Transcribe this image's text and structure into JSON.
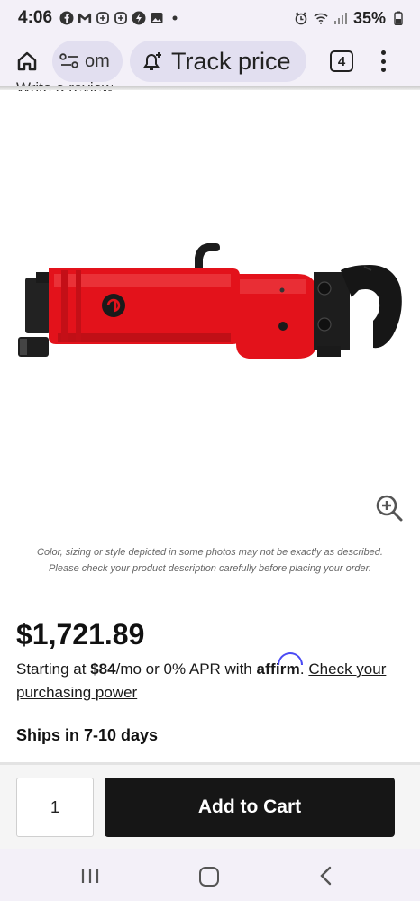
{
  "status_bar": {
    "time": "4:06",
    "battery": "35%",
    "left_icons": [
      "facebook-icon",
      "gmail-icon",
      "teams-icon",
      "teams-icon",
      "bolt-icon",
      "gallery-icon",
      "dot-icon"
    ],
    "right_icons": [
      "alarm-icon",
      "wifi-icon",
      "signal-icon",
      "battery-icon"
    ]
  },
  "browser": {
    "url_fragment": "om",
    "track_price_label": "Track price",
    "tab_count": "4"
  },
  "page": {
    "write_review": "Write a review",
    "disclaimer_line1": "Color, sizing or style depicted in some photos may not be exactly as described.",
    "disclaimer_line2": "Please check your product description carefully before placing your order.",
    "price": "$1,721.89",
    "financing_prefix": "Starting at ",
    "financing_amount": "$84",
    "financing_mid": "/mo or 0% APR with ",
    "affirm": "affirm",
    "financing_period": ".",
    "check_power": "Check your purchasing power",
    "shipping": "Ships in 7-10 days"
  },
  "cart": {
    "quantity": "1",
    "add_to_cart": "Add to Cart"
  },
  "colors": {
    "tool_red": "#e3121b",
    "cart_button": "#161616",
    "affirm_blue": "#4a4af4",
    "chrome_bg": "#f3f0f8"
  }
}
